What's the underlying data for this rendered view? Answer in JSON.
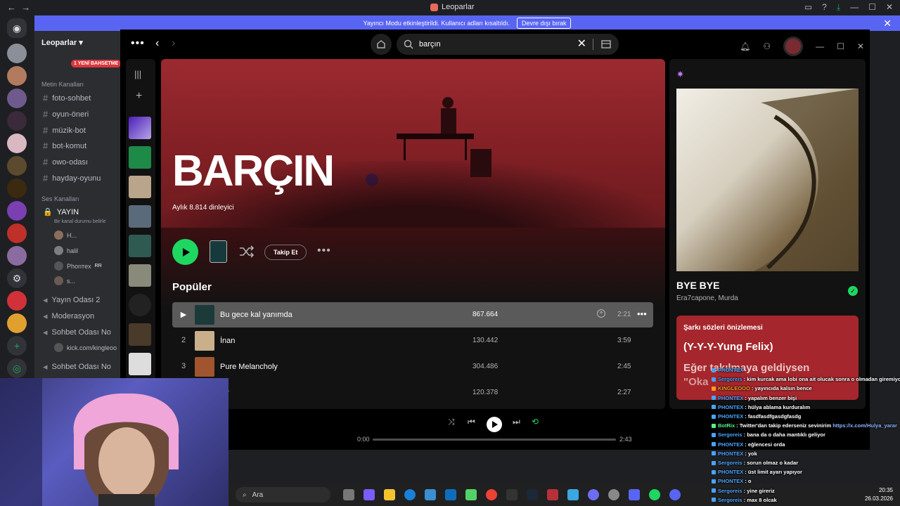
{
  "discord": {
    "window_title": "Leoparlar",
    "banner_text": "Yayıncı Modu etkinleştirildi. Kullanıcı adları kısaltıldı.",
    "banner_button": "Devre dışı bırak",
    "guild_name": "Leoparlar",
    "new_badge": "1 YENİ BAHSETME",
    "text_category": "Metin Kanalları",
    "text_channels": [
      "foto-sohbet",
      "oyun-öneri",
      "müzik-bot",
      "bot-komut",
      "owo-odası",
      "hayday-oyunu"
    ],
    "voice_category": "Ses Kanalları",
    "live_channel": "YAYIN",
    "live_status": "Bir kanal durumu belirle",
    "voice_users": [
      "H...",
      "halil",
      "Phonтex",
      "s..."
    ],
    "rr_tag": "RR",
    "voice_channels": [
      "Yayın Odası 2",
      "Moderasyon",
      "Sohbet Odası No",
      "Sohbet Odası No"
    ],
    "kick_link": "kick.com/kingleoo"
  },
  "spotify": {
    "search_value": "barçın",
    "artist": {
      "name": "BARÇIN",
      "listeners": "Aylık 8.814 dinleyici",
      "follow_label": "Takip Et"
    },
    "popular_label": "Popüler",
    "tracks": [
      {
        "num": "1",
        "title": "Bu gece kal yanımda",
        "plays": "867.664",
        "duration": "2:21"
      },
      {
        "num": "2",
        "title": "İnan",
        "plays": "130.442",
        "duration": "3:59"
      },
      {
        "num": "3",
        "title": "Pure Melancholy",
        "plays": "304.486",
        "duration": "2:45"
      },
      {
        "num": "",
        "title": "ter",
        "plays": "120.378",
        "duration": "2:27"
      }
    ],
    "now_playing": {
      "title": "BYE BYE",
      "artists": "Era7capone, Murda",
      "lyrics_header": "Şarkı sözleri önizlemesi",
      "lyrics_line1": "(Y-Y-Y-Yung Felix)",
      "lyrics_line2": "Eğer takılmaya geldiysen",
      "lyrics_line3": "\"Oka"
    },
    "player": {
      "elapsed": "0:00",
      "total": "2:43",
      "progress": 0
    }
  },
  "taskbar": {
    "search_placeholder": "Ara",
    "time": "20:35",
    "date": "26.03.2026"
  },
  "chat": [
    {
      "user": "PHONTEX",
      "text": "",
      "color": "#4aa3ff"
    },
    {
      "user": "Sergoreis",
      "text": ": kim kurcak ama lobi ona ait olucak sonra o olmadan giremiyoruz",
      "color": "#4aa3ff"
    },
    {
      "user": "KINGLEOOO",
      "text": ": yayıncıda kalsın bence",
      "color": "#ff9f1a"
    },
    {
      "user": "PHONTEX",
      "text": ": yapalım benzer bişi",
      "color": "#4aa3ff"
    },
    {
      "user": "PHONTEX",
      "text": ": hülya ablama kurduralım",
      "color": "#4aa3ff"
    },
    {
      "user": "PHONTEX",
      "text": ": fasdfasdfgasdgfasdg",
      "color": "#4aa3ff"
    },
    {
      "user": "BotRix",
      "text": ": Twitter'dan takip ederseniz sevinirim",
      "link": "https://x.com/Hulya_yarar",
      "color": "#57f287"
    },
    {
      "user": "Sergoreis",
      "text": ": bana da o daha mantıklı geliyor",
      "color": "#4aa3ff"
    },
    {
      "user": "PHONTEX",
      "text": ": eğlencesi orda",
      "color": "#4aa3ff"
    },
    {
      "user": "PHONTEX",
      "text": ": yok",
      "color": "#4aa3ff"
    },
    {
      "user": "Sergoreis",
      "text": ": sorun olmaz o kadar",
      "color": "#4aa3ff"
    },
    {
      "user": "PHONTEX",
      "text": ": üst limit ayarı yapıyor",
      "color": "#4aa3ff"
    },
    {
      "user": "PHONTEX",
      "text": ": o",
      "color": "#4aa3ff"
    },
    {
      "user": "Sergoreis",
      "text": ": yine gireriz",
      "color": "#4aa3ff"
    },
    {
      "user": "Sergoreis",
      "text": ": max 8 olcak",
      "color": "#4aa3ff"
    }
  ],
  "colors": {
    "spotify_green": "#1ed760",
    "discord_blurple": "#5865f2",
    "hero_red": "#9b2a30",
    "lyrics_red": "#a5262c"
  }
}
